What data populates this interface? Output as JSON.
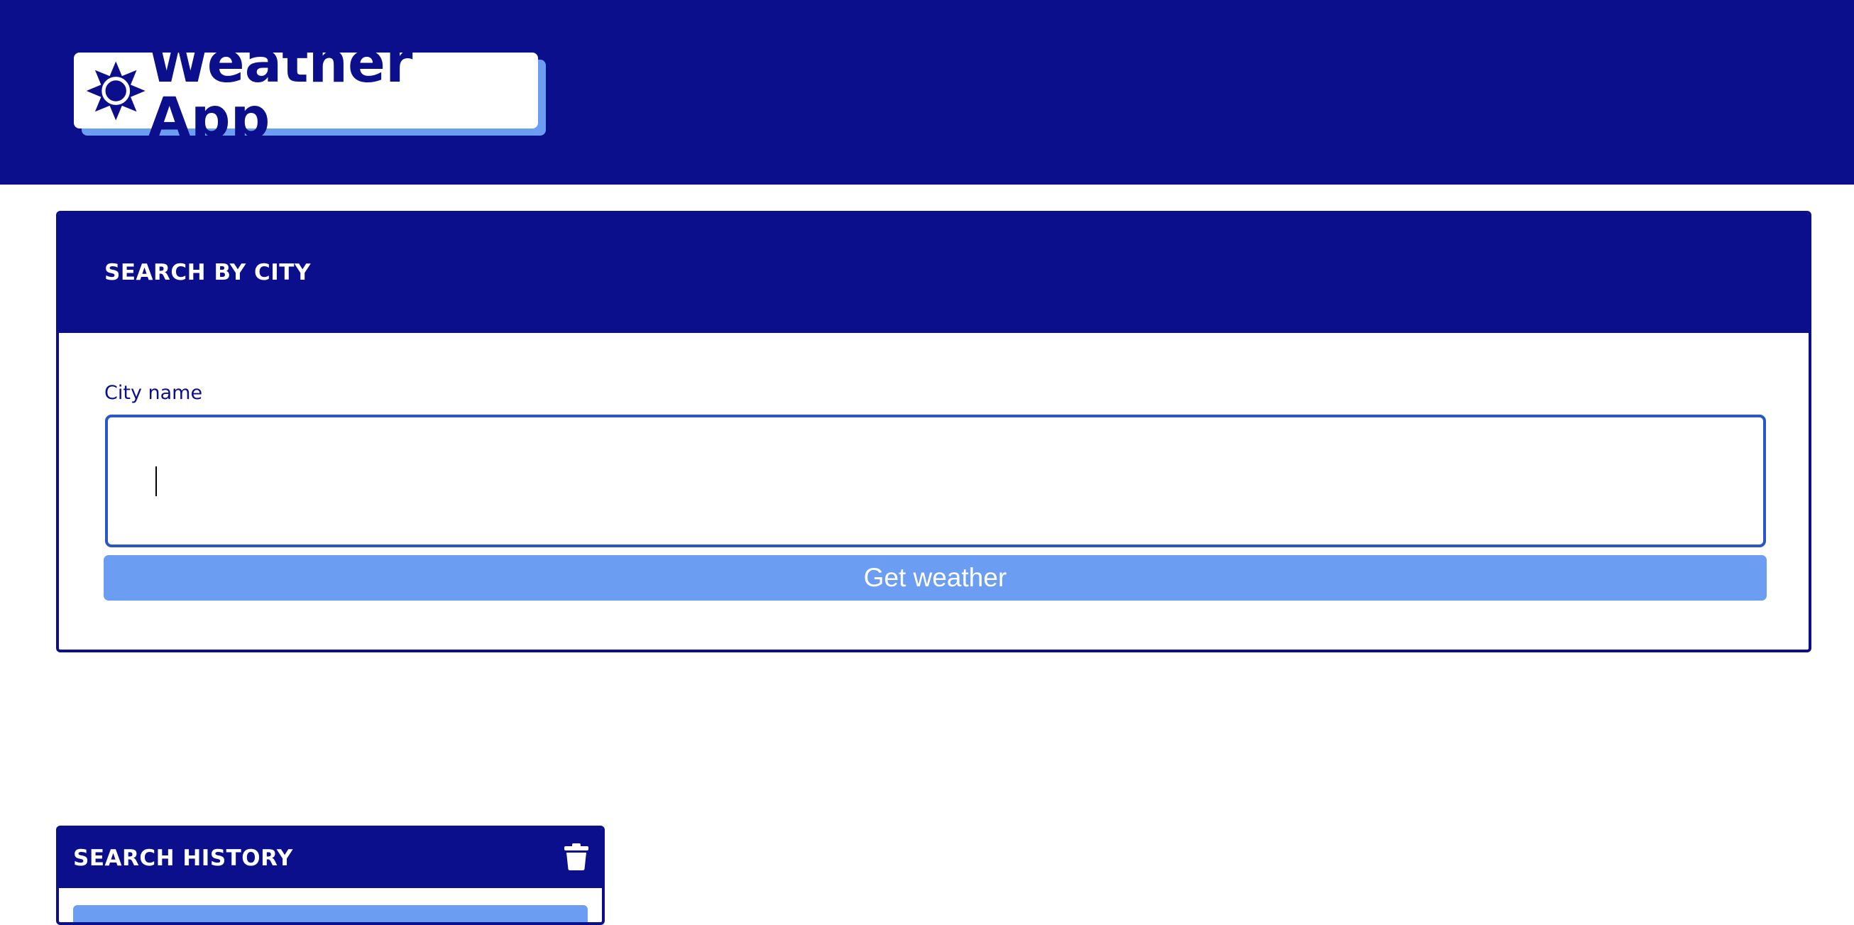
{
  "header": {
    "app_title": "Weather App",
    "logo_icon": "sun-icon",
    "background_color": "#0c0f8b"
  },
  "search": {
    "title": "SEARCH BY CITY",
    "field_label": "City name",
    "input_value": "",
    "button_label": "Get weather"
  },
  "history": {
    "title": "SEARCH HISTORY",
    "clear_icon": "trash-icon",
    "items": []
  },
  "colors": {
    "primary": "#0c0f8b",
    "accent": "#6b9ef2",
    "input_border": "#2a56c8"
  }
}
